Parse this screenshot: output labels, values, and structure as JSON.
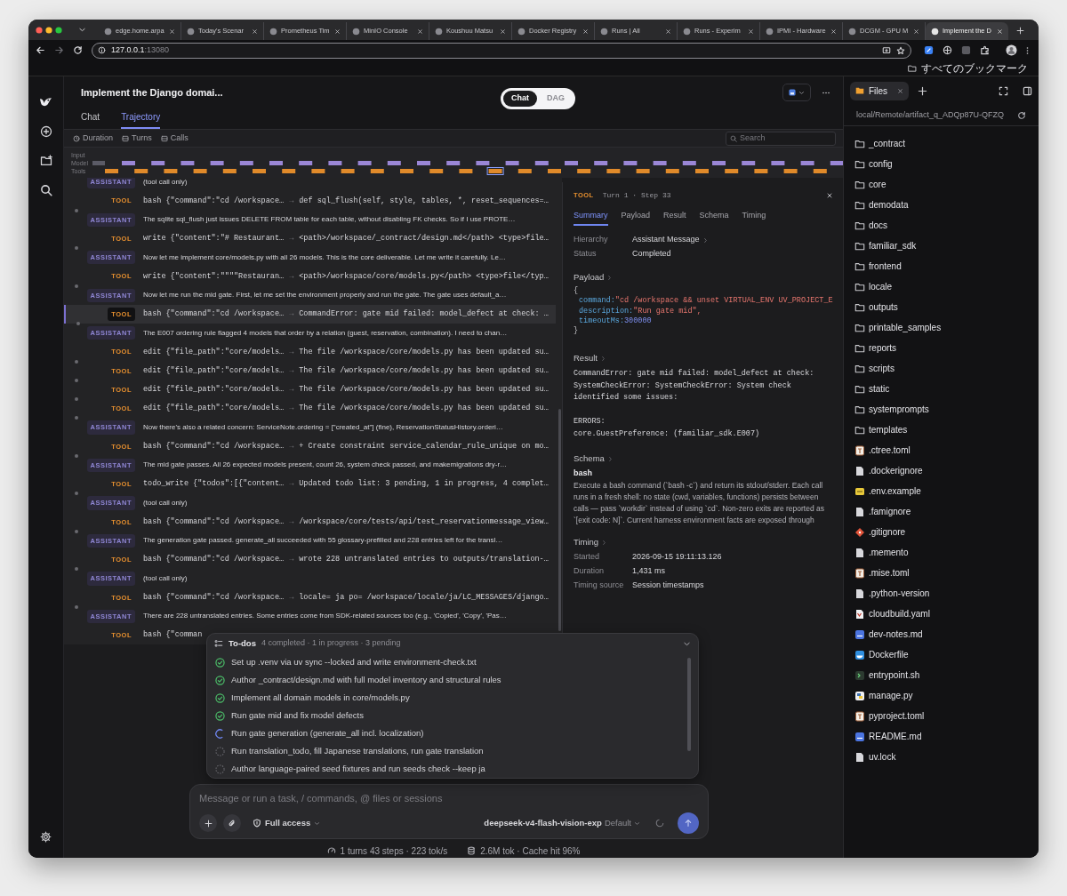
{
  "browser": {
    "tabs": [
      {
        "title": "edge.home.arpa",
        "selected": false
      },
      {
        "title": "Today's Scenar",
        "selected": false
      },
      {
        "title": "Prometheus Tim",
        "selected": false
      },
      {
        "title": "MinIO Console",
        "selected": false
      },
      {
        "title": "Koushuu Matsu",
        "selected": false
      },
      {
        "title": "Docker Registry",
        "selected": false
      },
      {
        "title": "Runs | All",
        "selected": false
      },
      {
        "title": "Runs - Experim",
        "selected": false
      },
      {
        "title": "IPMI - Hardware",
        "selected": false
      },
      {
        "title": "DCGM - GPU M",
        "selected": false
      },
      {
        "title": "Implement the D",
        "selected": true
      }
    ],
    "address": {
      "host": "127.0.0.1",
      "port": ":13080"
    },
    "bookmarks_label": "すべてのブックマーク"
  },
  "header": {
    "title": "Implement the Django domai...",
    "view_toggle": [
      {
        "label": "Chat",
        "selected": true
      },
      {
        "label": "DAG",
        "selected": false
      }
    ],
    "tabs": [
      {
        "label": "Chat",
        "selected": false
      },
      {
        "label": "Trajectory",
        "selected": true
      }
    ]
  },
  "filters": [
    {
      "kind": "clock",
      "label": "Duration"
    },
    {
      "kind": "list",
      "label": "Turns"
    },
    {
      "kind": "list",
      "label": "Calls"
    }
  ],
  "search": {
    "placeholder": "Search"
  },
  "timeline": {
    "labels": [
      "Input",
      "Model",
      "Tools"
    ]
  },
  "steps": [
    {
      "kind": "assistant",
      "label": "ASSISTANT",
      "text": "(tool call only)",
      "selected": false
    },
    {
      "kind": "tool",
      "label": "TOOL",
      "call": "bash {\"command\":\"cd /workspace…",
      "arrow": "→",
      "result": "def sql_flush(self, style, tables, *, reset_sequences=…",
      "selected": false
    },
    {
      "kind": "assistant",
      "label": "ASSISTANT",
      "text": "The sqlite sql_flush just issues DELETE FROM table for each table, without disabling FK checks. So if I use PROTE…",
      "selected": false
    },
    {
      "kind": "tool",
      "label": "TOOL",
      "call": "write {\"content\":\"# Restaurant…",
      "arrow": "→",
      "result": "<path>/workspace/_contract/design.md</path> <type>file…",
      "selected": false
    },
    {
      "kind": "assistant",
      "label": "ASSISTANT",
      "text": "Now let me implement core/models.py with all 26 models. This is the core deliverable. Let me write it carefully. Le…",
      "selected": false
    },
    {
      "kind": "tool",
      "label": "TOOL",
      "call": "write {\"content\":\"\"\"\"Restauran…",
      "arrow": "→",
      "result": "<path>/workspace/core/models.py</path> <type>file</typ…",
      "selected": false
    },
    {
      "kind": "assistant",
      "label": "ASSISTANT",
      "text": "Now let me run the mid gate. First, let me set the environment properly and run the gate. The gate uses default_a…",
      "selected": false
    },
    {
      "kind": "tool",
      "label": "TOOL",
      "call": "bash {\"command\":\"cd /workspace…",
      "arrow": "→",
      "result": "CommandError: gate mid failed: model_defect at check: …",
      "selected": true
    },
    {
      "kind": "assistant",
      "label": "ASSISTANT",
      "text": "The E007 ordering rule flagged 4 models that order by a relation (guest, reservation, combination). I need to chan…",
      "selected": false
    },
    {
      "kind": "tool",
      "label": "TOOL",
      "call": "edit {\"file_path\":\"core/models…",
      "arrow": "→",
      "result": "The file /workspace/core/models.py has been updated su…",
      "selected": false
    },
    {
      "kind": "tool",
      "label": "TOOL",
      "call": "edit {\"file_path\":\"core/models…",
      "arrow": "→",
      "result": "The file /workspace/core/models.py has been updated su…",
      "selected": false
    },
    {
      "kind": "tool",
      "label": "TOOL",
      "call": "edit {\"file_path\":\"core/models…",
      "arrow": "→",
      "result": "The file /workspace/core/models.py has been updated su…",
      "selected": false
    },
    {
      "kind": "tool",
      "label": "TOOL",
      "call": "edit {\"file_path\":\"core/models…",
      "arrow": "→",
      "result": "The file /workspace/core/models.py has been updated su…",
      "selected": false
    },
    {
      "kind": "assistant",
      "label": "ASSISTANT",
      "text": "Now there's also a related concern: ServiceNote.ordering = [\"created_at\"] (fine), ReservationStatusHistory.orderi…",
      "selected": false
    },
    {
      "kind": "tool",
      "label": "TOOL",
      "call": "bash {\"command\":\"cd /workspace…",
      "arrow": "→",
      "result": "+ Create constraint service_calendar_rule_unique on mo…",
      "selected": false
    },
    {
      "kind": "assistant",
      "label": "ASSISTANT",
      "text": "The mid gate passes. All 26 expected models present, count 26, system check passed, and makemigrations dry-r…",
      "selected": false
    },
    {
      "kind": "tool",
      "label": "TOOL",
      "call": "todo_write {\"todos\":[{\"content…",
      "arrow": "→",
      "result": "Updated todo list: 3 pending, 1 in progress, 4 complet…",
      "selected": false
    },
    {
      "kind": "assistant",
      "label": "ASSISTANT",
      "text": "(tool call only)",
      "selected": false
    },
    {
      "kind": "tool",
      "label": "TOOL",
      "call": "bash {\"command\":\"cd /workspace…",
      "arrow": "→",
      "result": "/workspace/core/tests/api/test_reservationmessage_view…",
      "selected": false
    },
    {
      "kind": "assistant",
      "label": "ASSISTANT",
      "text": "The generation gate passed. generate_all succeeded with 55 glossary-prefilled and 228 entries left for the transl…",
      "selected": false
    },
    {
      "kind": "tool",
      "label": "TOOL",
      "call": "bash {\"command\":\"cd /workspace…",
      "arrow": "→",
      "result": "wrote 228 untranslated entries to outputs/translation-…",
      "selected": false
    },
    {
      "kind": "assistant",
      "label": "ASSISTANT",
      "text": "(tool call only)",
      "selected": false
    },
    {
      "kind": "tool",
      "label": "TOOL",
      "call": "bash {\"command\":\"cd /workspace…",
      "arrow": "→",
      "result": "locale= ja po= /workspace/locale/ja/LC_MESSAGES/django…",
      "selected": false
    },
    {
      "kind": "assistant",
      "label": "ASSISTANT",
      "text": "There are 228 untranslated entries. Some entries come from SDK-related sources too (e.g., 'Copied', 'Copy', 'Pas…",
      "selected": false
    },
    {
      "kind": "tool",
      "label": "TOOL",
      "call": "bash {\"comman",
      "selected": false
    }
  ],
  "detail": {
    "kind_label": "TOOL",
    "position": "Turn 1 · Step 33",
    "tabs": [
      {
        "label": "Summary",
        "selected": true
      },
      {
        "label": "Payload",
        "selected": false
      },
      {
        "label": "Result",
        "selected": false
      },
      {
        "label": "Schema",
        "selected": false
      },
      {
        "label": "Timing",
        "selected": false
      }
    ],
    "summary": [
      {
        "label": "Hierarchy",
        "value": "Assistant Message",
        "link": true
      },
      {
        "label": "Status",
        "value": "Completed",
        "link": false
      }
    ],
    "payload": {
      "title": "Payload",
      "open": "{",
      "fields": [
        {
          "key": "command:",
          "value": "\"cd /workspace && unset VIRTUAL_ENV UV_PROJECT_E",
          "kind": "string"
        },
        {
          "key": "description:",
          "value": "\"Run gate mid\",",
          "kind": "string"
        },
        {
          "key": "timeoutMs:",
          "value": "300000",
          "kind": "number"
        }
      ],
      "close": "}"
    },
    "result": {
      "title": "Result",
      "text": "CommandError: gate mid failed: model_defect at check:\nSystemCheckError: SystemCheckError: System check\nidentified some issues:\n\nERRORS:\ncore.GuestPreference: (familiar_sdk.E007)"
    },
    "schema": {
      "title": "Schema",
      "name": "bash",
      "description": "Execute a bash command (`bash -c`) and return its stdout/stderr. Each call runs in a fresh shell: no state (cwd, variables, functions) persists between calls — pass `workdir` instead of using `cd`. Non-zero exits are reported as `[exit code: N]`. Current harness environment facts are exposed through"
    },
    "timing": {
      "title": "Timing",
      "rows": [
        {
          "label": "Started",
          "value": "2026-09-15 19:11:13.126"
        },
        {
          "label": "Duration",
          "value": "1,431 ms"
        },
        {
          "label": "Timing source",
          "value": "Session timestamps"
        }
      ]
    }
  },
  "files": {
    "tab": "Files",
    "path": "local/Remote/artifact_q_ADQp87U-QFZQ",
    "items": [
      {
        "kind": "folder",
        "name": "_contract"
      },
      {
        "kind": "folder",
        "name": "config"
      },
      {
        "kind": "folder",
        "name": "core"
      },
      {
        "kind": "folder",
        "name": "demodata"
      },
      {
        "kind": "folder",
        "name": "docs"
      },
      {
        "kind": "folder",
        "name": "familiar_sdk"
      },
      {
        "kind": "folder",
        "name": "frontend"
      },
      {
        "kind": "folder",
        "name": "locale"
      },
      {
        "kind": "folder",
        "name": "outputs"
      },
      {
        "kind": "folder",
        "name": "printable_samples"
      },
      {
        "kind": "folder",
        "name": "reports"
      },
      {
        "kind": "folder",
        "name": "scripts"
      },
      {
        "kind": "folder",
        "name": "static"
      },
      {
        "kind": "folder",
        "name": "systemprompts"
      },
      {
        "kind": "folder",
        "name": "templates"
      },
      {
        "kind": "toml",
        "name": ".ctree.toml"
      },
      {
        "kind": "plain",
        "name": ".dockerignore"
      },
      {
        "kind": "env",
        "name": ".env.example"
      },
      {
        "kind": "plain",
        "name": ".famignore"
      },
      {
        "kind": "git",
        "name": ".gitignore"
      },
      {
        "kind": "plain",
        "name": ".memento"
      },
      {
        "kind": "toml",
        "name": ".mise.toml"
      },
      {
        "kind": "plain",
        "name": ".python-version"
      },
      {
        "kind": "yaml",
        "name": "cloudbuild.yaml"
      },
      {
        "kind": "markdown",
        "name": "dev-notes.md"
      },
      {
        "kind": "docker",
        "name": "Dockerfile"
      },
      {
        "kind": "shell",
        "name": "entrypoint.sh"
      },
      {
        "kind": "python",
        "name": "manage.py"
      },
      {
        "kind": "toml",
        "name": "pyproject.toml"
      },
      {
        "kind": "markdown",
        "name": "README.md"
      },
      {
        "kind": "plain",
        "name": "uv.lock"
      }
    ]
  },
  "todos": {
    "title": "To-dos",
    "summary": "4 completed · 1 in progress · 3 pending",
    "items": [
      {
        "kind": "done",
        "text": "Set up .venv via uv sync --locked and write environment-check.txt"
      },
      {
        "kind": "done",
        "text": "Author _contract/design.md with full model inventory and structural rules"
      },
      {
        "kind": "done",
        "text": "Implement all domain models in core/models.py"
      },
      {
        "kind": "done",
        "text": "Run gate mid and fix model defects"
      },
      {
        "kind": "active",
        "text": "Run gate generation (generate_all incl. localization)"
      },
      {
        "kind": "pending",
        "text": "Run translation_todo, fill Japanese translations, run gate translation"
      },
      {
        "kind": "pending",
        "text": "Author language-paired seed fixtures and run seeds check --keep ja"
      }
    ]
  },
  "composer": {
    "placeholder": "Message or run a task, / commands, @ files or sessions",
    "access": "Full access",
    "model": "deepseek-v4-flash-vision-exp",
    "model_variant": "Default"
  },
  "stats": [
    {
      "kind": "speed",
      "text": "1 turns 43 steps · 223 tok/s"
    },
    {
      "kind": "storage",
      "text": "2.6M tok · Cache hit 96%"
    }
  ]
}
